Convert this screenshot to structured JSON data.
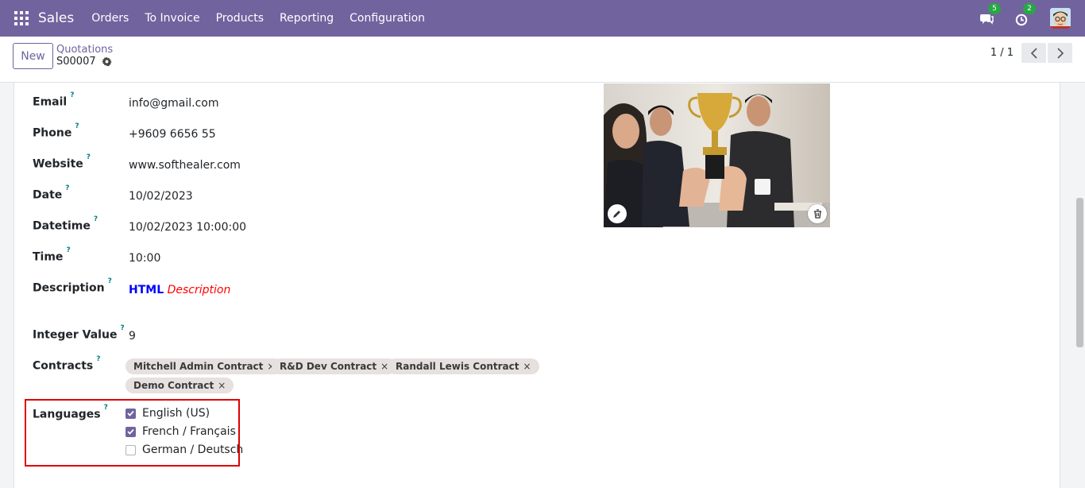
{
  "navbar": {
    "brand": "Sales",
    "menu": [
      "Orders",
      "To Invoice",
      "Products",
      "Reporting",
      "Configuration"
    ],
    "messages_count": "5",
    "activities_count": "2"
  },
  "control": {
    "new_label": "New",
    "breadcrumb": "Quotations",
    "record": "S00007",
    "pager": "1 / 1"
  },
  "form": {
    "fields": {
      "email": {
        "label": "Email",
        "value": "info@gmail.com"
      },
      "phone": {
        "label": "Phone",
        "value": "+9609 6656 55"
      },
      "website": {
        "label": "Website",
        "value": "www.softhealer.com"
      },
      "date": {
        "label": "Date",
        "value": "10/02/2023"
      },
      "datetime": {
        "label": "Datetime",
        "value": "10/02/2023 10:00:00"
      },
      "time": {
        "label": "Time",
        "value": "10:00"
      },
      "description": {
        "label": "Description",
        "bold": "HTML",
        "italic": "Description"
      },
      "integer": {
        "label": "Integer Value",
        "value": "9"
      },
      "contracts": {
        "label": "Contracts",
        "tags": [
          "Mitchell Admin Contract",
          "R&D Dev Contract",
          "Randall Lewis Contract",
          "Demo Contract"
        ]
      },
      "languages": {
        "label": "Languages",
        "options": [
          {
            "label": "English (US)",
            "checked": true
          },
          {
            "label": "French / Français",
            "checked": true
          },
          {
            "label": "German / Deutsch",
            "checked": false
          }
        ]
      }
    },
    "help_mark": "?",
    "tag_remove": "×"
  },
  "icons": {
    "apps": "apps-grid-icon",
    "messages": "chat-icon",
    "activities": "clock-icon",
    "gear": "gear-icon",
    "edit": "pencil-icon",
    "delete": "trash-icon"
  },
  "colors": {
    "brand": "#71639e",
    "badge": "#28a745",
    "highlight": "#e00000",
    "help": "#017e84"
  }
}
